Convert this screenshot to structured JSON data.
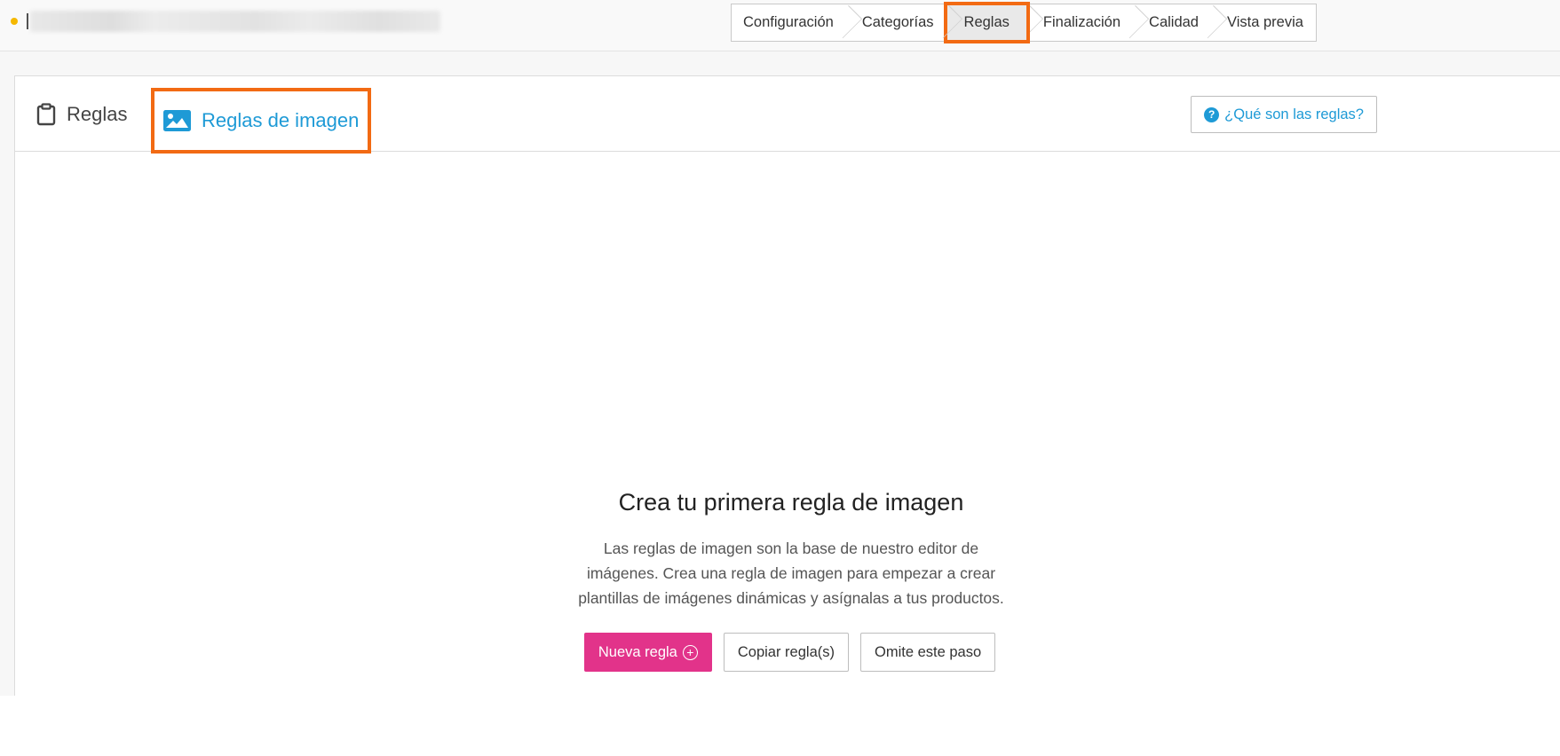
{
  "header": {
    "document_title": "",
    "status_color": "#f5b800",
    "steps": [
      {
        "label": "Configuración",
        "active": false
      },
      {
        "label": "Categorías",
        "active": false
      },
      {
        "label": "Reglas",
        "active": true
      },
      {
        "label": "Finalización",
        "active": false
      },
      {
        "label": "Calidad",
        "active": false
      },
      {
        "label": "Vista previa",
        "active": false
      }
    ]
  },
  "tabs": {
    "rules": {
      "label": "Reglas",
      "icon": "clipboard-icon"
    },
    "image_rules": {
      "label": "Reglas de imagen",
      "icon": "image-icon",
      "active": true
    }
  },
  "help": {
    "label": "¿Qué son las reglas?",
    "icon": "question-circle-icon"
  },
  "empty_state": {
    "title": "Crea tu primera regla de imagen",
    "description": "Las reglas de imagen son la base de nuestro editor de imágenes. Crea una regla de imagen para empezar a crear plantillas de imágenes dinámicas y asígnalas a tus productos.",
    "buttons": {
      "new_rule": "Nueva regla",
      "copy_rules": "Copiar regla(s)",
      "skip_step": "Omite este paso"
    }
  },
  "colors": {
    "accent_blue": "#1e9ad6",
    "primary_pink": "#e2338a",
    "highlight_orange": "#f26a13"
  }
}
